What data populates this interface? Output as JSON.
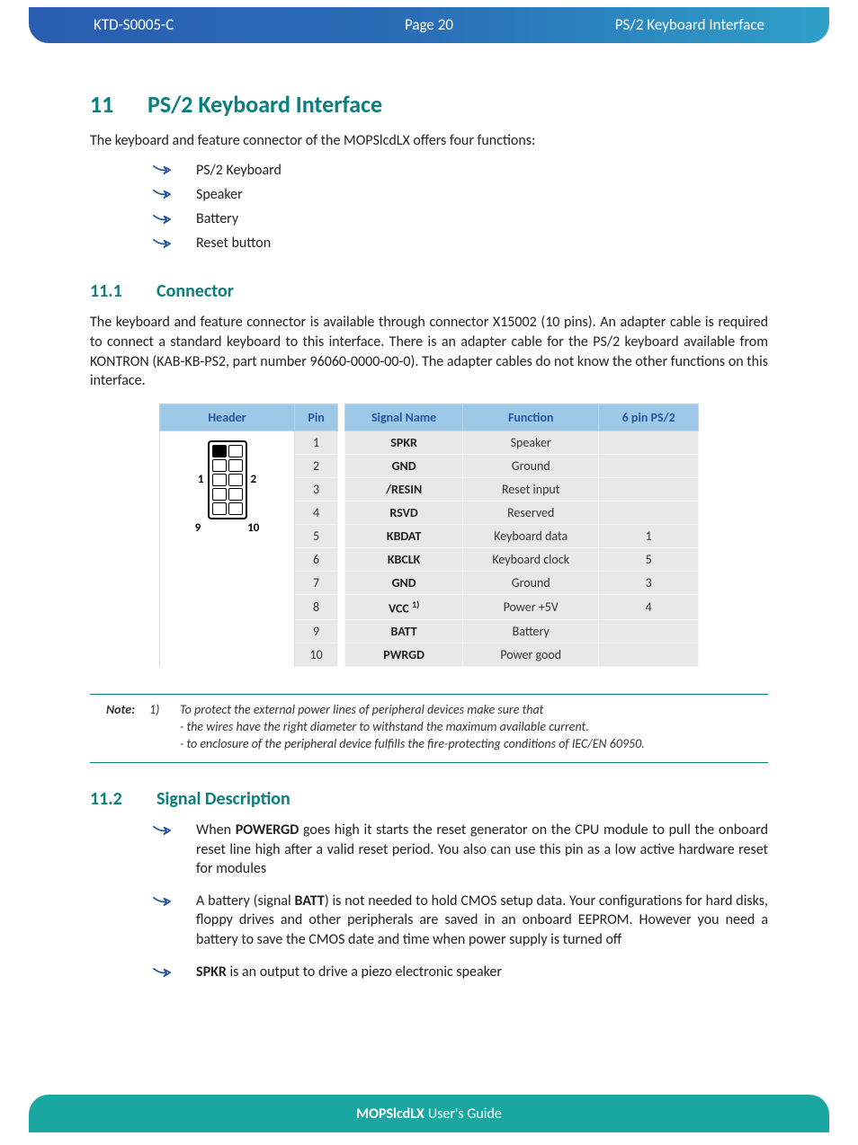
{
  "header": {
    "doc_id": "KTD-S0005-C",
    "page": "Page 20",
    "title": "PS/2 Keyboard Interface"
  },
  "h1": {
    "num": "11",
    "title": "PS/2 Keyboard Interface"
  },
  "intro": "The keyboard and feature connector of the MOPSlcdLX offers four functions:",
  "intro_items": [
    "PS/2 Keyboard",
    "Speaker",
    "Battery",
    "Reset button"
  ],
  "s11_1": {
    "num": "11.1",
    "title": "Connector"
  },
  "s11_1_body": "The keyboard and feature connector is available through connector X15002 (10 pins). An adapter cable is required to connect a standard keyboard to this interface. There is an adapter cable for the PS/2 keyboard available from KONTRON (KAB-KB-PS2, part number 96060-0000-00-0). The adapter cables do not know the other functions on this interface.",
  "table": {
    "cols": [
      "Header",
      "Pin",
      "Signal Name",
      "Function",
      "6 pin PS/2"
    ],
    "header_labels": {
      "tl": "1",
      "tr": "2",
      "bl": "9",
      "br": "10"
    },
    "rows": [
      {
        "pin": "1",
        "sig": "SPKR",
        "func": "Speaker",
        "ps2": ""
      },
      {
        "pin": "2",
        "sig": "GND",
        "func": "Ground",
        "ps2": ""
      },
      {
        "pin": "3",
        "sig": "/RESIN",
        "func": "Reset input",
        "ps2": ""
      },
      {
        "pin": "4",
        "sig": "RSVD",
        "func": "Reserved",
        "ps2": ""
      },
      {
        "pin": "5",
        "sig": "KBDAT",
        "func": "Keyboard data",
        "ps2": "1"
      },
      {
        "pin": "6",
        "sig": "KBCLK",
        "func": "Keyboard clock",
        "ps2": "5"
      },
      {
        "pin": "7",
        "sig": "GND",
        "func": "Ground",
        "ps2": "3"
      },
      {
        "pin": "8",
        "sig": "VCC",
        "sup": "1)",
        "func": "Power +5V",
        "ps2": "4"
      },
      {
        "pin": "9",
        "sig": "BATT",
        "func": "Battery",
        "ps2": ""
      },
      {
        "pin": "10",
        "sig": "PWRGD",
        "func": "Power good",
        "ps2": ""
      }
    ]
  },
  "note": {
    "label": "Note:",
    "num": "1)",
    "line1": "To protect the external power lines of peripheral devices make sure that",
    "line2": "- the wires have the right diameter to withstand the maximum available current.",
    "line3": "- to enclosure of the peripheral device fulfills the fire-protecting conditions of IEC/EN 60950."
  },
  "s11_2": {
    "num": "11.2",
    "title": "Signal Description"
  },
  "sig_items": [
    {
      "b": "POWERGD",
      "pre": "When ",
      "post": " goes high it starts the reset generator on the CPU module to pull the onboard reset line high after a valid reset period. You also can use this pin as a low active hardware reset for modules"
    },
    {
      "b": "BATT",
      "pre": "A battery (signal ",
      "post": ") is not needed to hold CMOS setup data. Your configurations for hard disks, floppy drives and other peripherals are saved in an onboard EEPROM. However you need a battery to save the CMOS date and time when power supply is turned off"
    },
    {
      "b": "SPKR",
      "pre": "",
      "post": " is an output to drive a piezo electronic speaker"
    }
  ],
  "footer": {
    "bold": "MOPSlcdLX",
    "rest": " User's Guide"
  }
}
